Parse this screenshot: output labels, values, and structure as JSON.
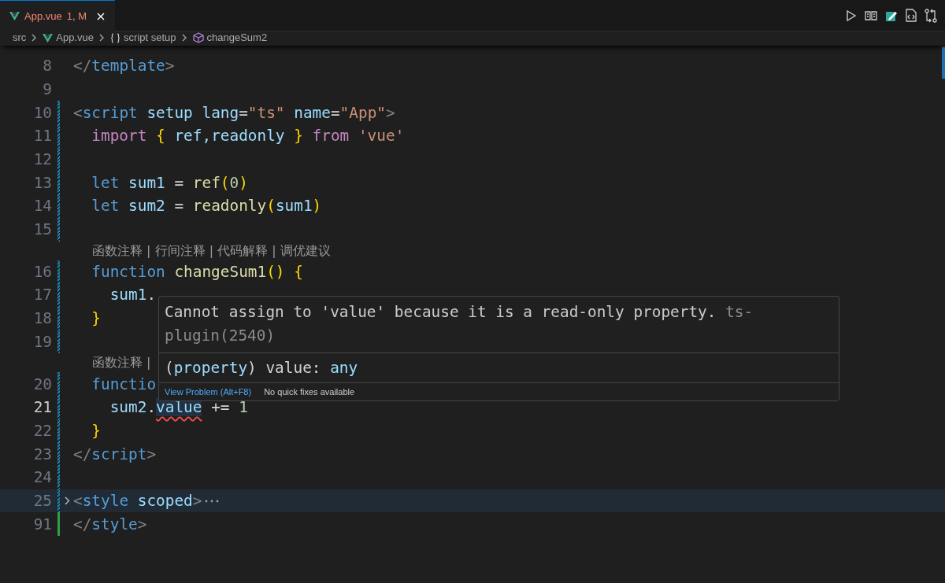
{
  "tabs": [
    {
      "label": "App.vue",
      "badge": "1, M",
      "selected": true
    }
  ],
  "breadcrumbs": [
    {
      "text": "src",
      "kind": "folder"
    },
    {
      "text": "App.vue",
      "kind": "vue"
    },
    {
      "text": "script setup",
      "kind": "braces"
    },
    {
      "text": "changeSum2",
      "kind": "cube"
    }
  ],
  "lines": [
    {
      "kind": "code",
      "number": "8",
      "modified": false,
      "added": false,
      "tokens": [
        {
          "t": "</",
          "kind": "punct"
        },
        {
          "t": "template",
          "kind": "tag"
        },
        {
          "t": ">",
          "kind": "punct"
        }
      ]
    },
    {
      "kind": "code",
      "number": "9",
      "modified": false,
      "added": false
    },
    {
      "kind": "code",
      "number": "10",
      "modified": true,
      "added": false,
      "tokens": [
        {
          "t": "<",
          "kind": "punct"
        },
        {
          "t": "script",
          "kind": "tag"
        },
        {
          "t": " setup lang",
          "kind": "attr"
        },
        {
          "t": "=",
          "kind": "plain"
        },
        {
          "t": "\"ts\"",
          "kind": "string"
        },
        {
          "t": " name",
          "kind": "attr"
        },
        {
          "t": "=",
          "kind": "plain"
        },
        {
          "t": "\"App\"",
          "kind": "string"
        },
        {
          "t": ">",
          "kind": "punct"
        }
      ]
    },
    {
      "kind": "code",
      "number": "11",
      "modified": true,
      "added": false,
      "tokens": [
        {
          "t": "  import",
          "kind": "keyword"
        },
        {
          "t": " { ",
          "kind": "bracket"
        },
        {
          "t": "ref,readonly",
          "kind": "var"
        },
        {
          "t": " } ",
          "kind": "bracket"
        },
        {
          "t": "from",
          "kind": "keyword"
        },
        {
          "t": " 'vue'",
          "kind": "string"
        }
      ]
    },
    {
      "kind": "code",
      "number": "12",
      "modified": true,
      "added": false
    },
    {
      "kind": "code",
      "number": "13",
      "modified": true,
      "added": false,
      "tokens": [
        {
          "t": "  let",
          "kind": "storage"
        },
        {
          "t": " sum1 ",
          "kind": "var"
        },
        {
          "t": "= ",
          "kind": "plain"
        },
        {
          "t": "ref",
          "kind": "func"
        },
        {
          "t": "(",
          "kind": "bracket"
        },
        {
          "t": "0",
          "kind": "number"
        },
        {
          "t": ")",
          "kind": "bracket"
        }
      ]
    },
    {
      "kind": "code",
      "number": "14",
      "modified": true,
      "added": false,
      "tokens": [
        {
          "t": "  let",
          "kind": "storage"
        },
        {
          "t": " sum2 ",
          "kind": "var"
        },
        {
          "t": "= ",
          "kind": "plain"
        },
        {
          "t": "readonly",
          "kind": "func"
        },
        {
          "t": "(",
          "kind": "bracket"
        },
        {
          "t": "sum1",
          "kind": "var"
        },
        {
          "t": ")",
          "kind": "bracket"
        }
      ]
    },
    {
      "kind": "code",
      "number": "15",
      "modified": true,
      "added": false
    },
    {
      "kind": "codelens",
      "text": "函数注释 | 行间注释 | 代码解释 | 调优建议"
    },
    {
      "kind": "code",
      "number": "16",
      "modified": true,
      "added": false,
      "tokens": [
        {
          "t": "  function",
          "kind": "storage"
        },
        {
          "t": " changeSum1",
          "kind": "func"
        },
        {
          "t": "() {",
          "kind": "bracket"
        }
      ]
    },
    {
      "kind": "code",
      "number": "17",
      "modified": true,
      "added": false,
      "tokens": [
        {
          "t": "    sum1",
          "kind": "var"
        },
        {
          "t": ".",
          "kind": "plain"
        }
      ]
    },
    {
      "kind": "code",
      "number": "18",
      "modified": true,
      "added": false,
      "tokens": [
        {
          "t": "  }",
          "kind": "bracket"
        }
      ]
    },
    {
      "kind": "code",
      "number": "19",
      "modified": true,
      "added": false
    },
    {
      "kind": "codelens",
      "text": "函数注释 |"
    },
    {
      "kind": "code",
      "number": "20",
      "modified": true,
      "added": false,
      "tokens": [
        {
          "t": "  functio",
          "kind": "storage"
        }
      ]
    },
    {
      "kind": "code",
      "number": "21",
      "modified": true,
      "added": false,
      "current": true,
      "tokens": [
        {
          "t": "    sum2",
          "kind": "var"
        },
        {
          "t": ".",
          "kind": "plain"
        },
        {
          "t": "value",
          "kind": "var",
          "error": true
        },
        {
          "t": " += ",
          "kind": "plain"
        },
        {
          "t": "1",
          "kind": "number"
        }
      ]
    },
    {
      "kind": "code",
      "number": "22",
      "modified": true,
      "added": false,
      "tokens": [
        {
          "t": "  }",
          "kind": "bracket"
        }
      ]
    },
    {
      "kind": "code",
      "number": "23",
      "modified": true,
      "added": false,
      "tokens": [
        {
          "t": "</",
          "kind": "punct"
        },
        {
          "t": "script",
          "kind": "tag"
        },
        {
          "t": ">",
          "kind": "punct"
        }
      ]
    },
    {
      "kind": "code",
      "number": "24",
      "modified": true,
      "added": false
    },
    {
      "kind": "code",
      "number": "25",
      "modified": true,
      "added": false,
      "folded": true,
      "tokens": [
        {
          "t": "<",
          "kind": "punct"
        },
        {
          "t": "style",
          "kind": "tag"
        },
        {
          "t": " scoped",
          "kind": "attr"
        },
        {
          "t": ">",
          "kind": "punct"
        }
      ]
    },
    {
      "kind": "code",
      "number": "91",
      "modified": false,
      "added": true,
      "tokens": [
        {
          "t": "</",
          "kind": "punct"
        },
        {
          "t": "style",
          "kind": "tag"
        },
        {
          "t": ">",
          "kind": "punct"
        }
      ]
    }
  ],
  "hover": {
    "message": "Cannot assign to 'value' because it is a read-only property.",
    "source": "ts-plugin(2540)",
    "signature": [
      {
        "t": "(",
        "kind": "plain"
      },
      {
        "t": "property",
        "kind": "var"
      },
      {
        "t": ") value: ",
        "kind": "plain"
      },
      {
        "t": "any",
        "kind": "var"
      }
    ],
    "actions": [
      {
        "label": "View Problem (Alt+F8)",
        "kind": "link"
      },
      {
        "label": "No quick fixes available",
        "kind": "note"
      }
    ]
  }
}
